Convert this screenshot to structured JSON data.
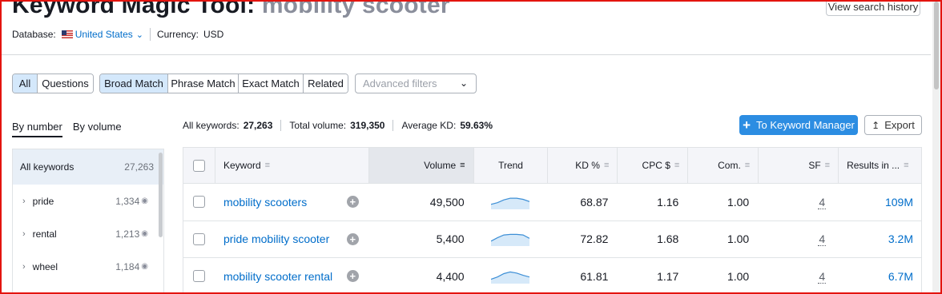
{
  "header": {
    "title_prefix": "Keyword Magic Tool:",
    "title_query": "mobility scooter",
    "history_button": "View search history",
    "database_label": "Database:",
    "database_value": "United States",
    "currency_label": "Currency:",
    "currency_value": "USD"
  },
  "tabs_group1": [
    "All",
    "Questions"
  ],
  "tabs_group2": [
    "Broad Match",
    "Phrase Match",
    "Exact Match",
    "Related"
  ],
  "advanced_filters": {
    "placeholder": "Advanced filters"
  },
  "sort_tabs": [
    "By number",
    "By volume"
  ],
  "stats": {
    "keywords_label": "All keywords:",
    "keywords_value": "27,263",
    "volume_label": "Total volume:",
    "volume_value": "319,350",
    "kd_label": "Average KD:",
    "kd_value": "59.63%"
  },
  "actions": {
    "keyword_manager": "To Keyword Manager",
    "export": "Export"
  },
  "sidebar": {
    "all": {
      "label": "All keywords",
      "count": "27,263"
    },
    "groups": [
      {
        "label": "pride",
        "count": "1,334"
      },
      {
        "label": "rental",
        "count": "1,213"
      },
      {
        "label": "wheel",
        "count": "1,184"
      }
    ]
  },
  "table": {
    "columns": [
      "Keyword",
      "Volume",
      "Trend",
      "KD %",
      "CPC $",
      "Com.",
      "SF",
      "Results in ..."
    ],
    "rows": [
      {
        "keyword": "mobility scooters",
        "volume": "49,500",
        "kd": "68.87",
        "cpc": "1.16",
        "com": "1.00",
        "sf": "4",
        "results": "109M",
        "trend": [
          0.3,
          0.45,
          0.7,
          0.85,
          0.85,
          0.75,
          0.55
        ]
      },
      {
        "keyword": "pride mobility scooter",
        "volume": "5,400",
        "kd": "72.82",
        "cpc": "1.68",
        "com": "1.00",
        "sf": "4",
        "results": "3.2M",
        "trend": [
          0.3,
          0.6,
          0.85,
          0.9,
          0.9,
          0.85,
          0.55
        ]
      },
      {
        "keyword": "mobility scooter rental",
        "volume": "4,400",
        "kd": "61.81",
        "cpc": "1.17",
        "com": "1.00",
        "sf": "4",
        "results": "6.7M",
        "trend": [
          0.25,
          0.45,
          0.75,
          0.9,
          0.8,
          0.6,
          0.45
        ]
      }
    ]
  },
  "colors": {
    "accent": "#2c8de2",
    "link": "#006dca",
    "active_tab": "#d4e8fb"
  }
}
